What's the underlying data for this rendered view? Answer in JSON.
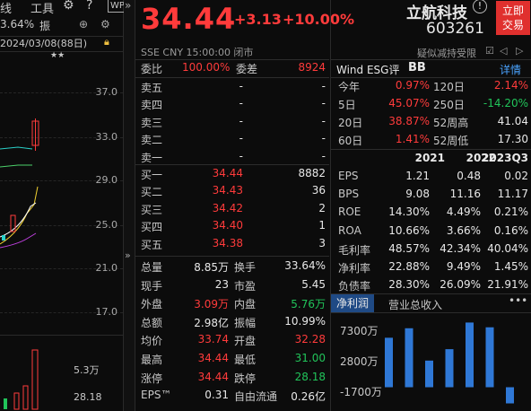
{
  "left_panel": {
    "toolbar": [
      "线",
      "工具"
    ],
    "pct_partial": "3.64%",
    "zhen": "振",
    "date_label": "2024/03/08(88日)",
    "stars": "★★",
    "y_ticks": [
      "37.0",
      "33.0",
      "29.0",
      "25.0",
      "21.0",
      "17.0"
    ],
    "volume_label": "5.3万",
    "volume_label2": "28.18"
  },
  "header": {
    "price": "34.44",
    "change": "+3.13",
    "change_pct": "+10.00%",
    "name": "立航科技",
    "code": "603261",
    "trade_btn": "立即\n交易",
    "meta": "SSE  CNY  15:00:00  闭市",
    "note": "疑似减持受限",
    "icons": [
      "gear-icon",
      "help-icon",
      "wp-icon"
    ]
  },
  "orderbook": {
    "weibi_label": "委比",
    "weibi_value": "100.00%",
    "weicha_label": "委差",
    "weicha_value": "8924",
    "sells": [
      {
        "label": "卖五",
        "price": "-",
        "vol": "-"
      },
      {
        "label": "卖四",
        "price": "-",
        "vol": "-"
      },
      {
        "label": "卖三",
        "price": "-",
        "vol": "-"
      },
      {
        "label": "卖二",
        "price": "-",
        "vol": "-"
      },
      {
        "label": "卖一",
        "price": "-",
        "vol": "-"
      }
    ],
    "buys": [
      {
        "label": "买一",
        "price": "34.44",
        "vol": "8882"
      },
      {
        "label": "买二",
        "price": "34.43",
        "vol": "36"
      },
      {
        "label": "买三",
        "price": "34.42",
        "vol": "2"
      },
      {
        "label": "买四",
        "price": "34.40",
        "vol": "1"
      },
      {
        "label": "买五",
        "price": "34.38",
        "vol": "3"
      }
    ]
  },
  "stats": [
    {
      "l1": "总量",
      "v1": "8.85万",
      "c1": "white",
      "l2": "换手",
      "v2": "33.64%",
      "c2": "white"
    },
    {
      "l1": "现手",
      "v1": "23",
      "c1": "white",
      "l2": "市盈",
      "v2": "5.45",
      "c2": "white"
    },
    {
      "l1": "外盘",
      "v1": "3.09万",
      "c1": "red",
      "l2": "内盘",
      "v2": "5.76万",
      "c2": "green"
    },
    {
      "l1": "总额",
      "v1": "2.98亿",
      "c1": "white",
      "l2": "振幅",
      "v2": "10.99%",
      "c2": "white"
    },
    {
      "l1": "均价",
      "v1": "33.74",
      "c1": "red",
      "l2": "开盘",
      "v2": "32.28",
      "c2": "red"
    },
    {
      "l1": "最高",
      "v1": "34.44",
      "c1": "red",
      "l2": "最低",
      "v2": "31.00",
      "c2": "green"
    },
    {
      "l1": "涨停",
      "v1": "34.44",
      "c1": "red",
      "l2": "跌停",
      "v2": "28.18",
      "c2": "green"
    },
    {
      "l1": "EPS™",
      "v1": "0.31",
      "c1": "white",
      "l2": "自由流通",
      "v2": "0.26亿",
      "c2": "white"
    }
  ],
  "right_panel": {
    "wind_label": "Wind ESG评",
    "rating": "BB",
    "detail": "详情",
    "periods": [
      {
        "l1": "今年",
        "v1": "0.97%",
        "c1": "red",
        "l2": "120日",
        "v2": "2.14%",
        "c2": "red"
      },
      {
        "l1": "5日",
        "v1": "45.07%",
        "c1": "red",
        "l2": "250日",
        "v2": "-14.20%",
        "c2": "green"
      },
      {
        "l1": "20日",
        "v1": "38.87%",
        "c1": "red",
        "l2": "52周高",
        "v2": "41.04",
        "c2": "white"
      },
      {
        "l1": "60日",
        "v1": "1.41%",
        "c1": "red",
        "l2": "52周低",
        "v2": "17.30",
        "c2": "white"
      }
    ],
    "fin_headers": [
      "2021",
      "2022",
      "2023Q3"
    ],
    "fin_rows": [
      {
        "label": "EPS",
        "vals": [
          "1.21",
          "0.48",
          "0.02"
        ]
      },
      {
        "label": "BPS",
        "vals": [
          "9.08",
          "11.16",
          "11.17"
        ]
      },
      {
        "label": "ROE",
        "vals": [
          "14.30%",
          "4.49%",
          "0.21%"
        ]
      },
      {
        "label": "ROA",
        "vals": [
          "10.66%",
          "3.66%",
          "0.16%"
        ]
      },
      {
        "label": "毛利率",
        "vals": [
          "48.57%",
          "42.34%",
          "40.04%"
        ]
      },
      {
        "label": "净利率",
        "vals": [
          "22.88%",
          "9.49%",
          "1.45%"
        ]
      },
      {
        "label": "负债率",
        "vals": [
          "28.30%",
          "26.09%",
          "21.91%"
        ]
      }
    ],
    "tabs": [
      "净利润",
      "营业总收入"
    ],
    "chart_axis": [
      "7300万",
      "2800万",
      "-1700万"
    ]
  },
  "chart_data": {
    "type": "bar",
    "ylim": [
      -2500,
      7500
    ],
    "values": [
      5200,
      6200,
      2800,
      4000,
      6800,
      6300,
      -1700
    ]
  },
  "colors": {
    "up": "#ff3b3b",
    "down": "#21c45a",
    "accent": "#4aa3ff",
    "bar": "#2f78d6"
  }
}
